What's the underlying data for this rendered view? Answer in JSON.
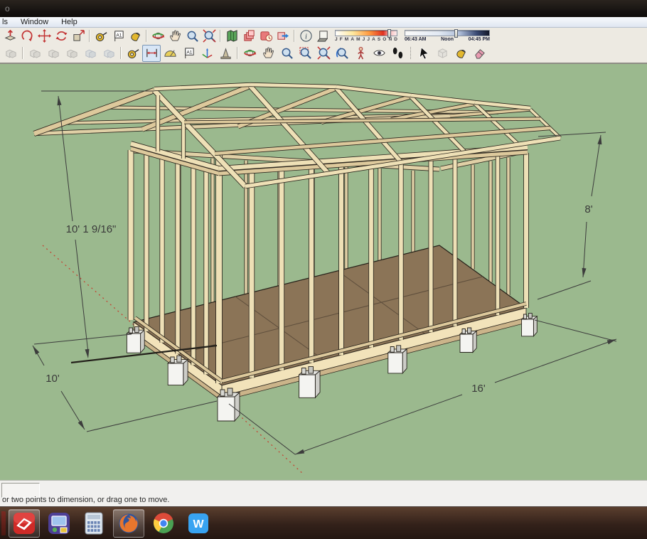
{
  "window": {
    "title_hint": "o"
  },
  "menubar": {
    "items": [
      "ls",
      "Window",
      "Help"
    ]
  },
  "shadows": {
    "months": [
      "J",
      "F",
      "M",
      "A",
      "M",
      "J",
      "J",
      "A",
      "S",
      "O",
      "N",
      "D"
    ],
    "month_handle": 0.84,
    "time_handle": 0.58,
    "time_start": "06:43 AM",
    "time_mid": "Noon",
    "time_end": "04:45 PM"
  },
  "toolbar_row1": {
    "icons": [
      {
        "name": "push-pull",
        "glyph": "pushpull",
        "color": "#c23232"
      },
      {
        "name": "follow-me",
        "glyph": "follow",
        "color": "#c23232"
      },
      {
        "name": "move",
        "glyph": "move",
        "color": "#c23232"
      },
      {
        "name": "rotate",
        "glyph": "rotate",
        "color": "#c23232"
      },
      {
        "name": "scale",
        "glyph": "scale",
        "color": "#c23232"
      },
      {
        "name": "tape-measure",
        "glyph": "tape",
        "color": "#e2b72e",
        "separator": true
      },
      {
        "name": "text",
        "glyph": "a1",
        "color": "#444444"
      },
      {
        "name": "paint-bucket",
        "glyph": "bucket",
        "color": "#e2b72e"
      },
      {
        "name": "orbit",
        "glyph": "orbit",
        "color": "#3a9d3a",
        "separator": true
      },
      {
        "name": "pan",
        "glyph": "hand",
        "color": "#f3e3cb"
      },
      {
        "name": "zoom",
        "glyph": "mag",
        "color": "#4a7ab5"
      },
      {
        "name": "zoom-extents",
        "glyph": "magx",
        "color": "#4a7ab5"
      },
      {
        "name": "add-location",
        "glyph": "map",
        "color": "#5aa55a",
        "separator": true
      },
      {
        "name": "toggle-terrain",
        "glyph": "stack",
        "color": "#c23232"
      },
      {
        "name": "photo-textures",
        "glyph": "clock",
        "color": "#c23232"
      },
      {
        "name": "share-model",
        "glyph": "arrowblue",
        "color": "#2e7fd6"
      },
      {
        "name": "shadow-settings",
        "glyph": "info",
        "color": "#334455",
        "separator": true
      },
      {
        "name": "shadow-toggle",
        "glyph": "shadowbox",
        "color": "#555555"
      },
      {
        "slider": "month"
      },
      {
        "slider": "time"
      }
    ]
  },
  "toolbar_row2": {
    "icons": [
      {
        "name": "outer-shell",
        "glyph": "cubes",
        "color": "#888888",
        "disabled": true
      },
      {
        "name": "solid-union",
        "glyph": "cubes",
        "color": "#888888",
        "disabled": true,
        "separator": true
      },
      {
        "name": "solid-subtract",
        "glyph": "cubes",
        "color": "#888888",
        "disabled": true
      },
      {
        "name": "solid-trim",
        "glyph": "cubes",
        "color": "#888888",
        "disabled": true
      },
      {
        "name": "solid-intersect",
        "glyph": "cubes2",
        "color": "#6aa0d8",
        "disabled": true
      },
      {
        "name": "solid-split",
        "glyph": "cubes2",
        "color": "#6aa0d8",
        "disabled": true
      },
      {
        "name": "tape-measure-2",
        "glyph": "tape",
        "color": "#e2b72e",
        "separator": true
      },
      {
        "name": "dimension",
        "glyph": "dim",
        "color": "#444444",
        "selected": true
      },
      {
        "name": "protractor",
        "glyph": "protractor",
        "color": "#e8cf5a"
      },
      {
        "name": "text-2",
        "glyph": "a1",
        "color": "#444444"
      },
      {
        "name": "axes",
        "glyph": "axes",
        "color": "#c23232"
      },
      {
        "name": "3d-text",
        "glyph": "text3d",
        "color": "#b0a080"
      },
      {
        "name": "orbit-2",
        "glyph": "orbit",
        "color": "#3a9d3a",
        "separator": true
      },
      {
        "name": "pan-2",
        "glyph": "hand",
        "color": "#f3e3cb"
      },
      {
        "name": "zoom-2",
        "glyph": "mag",
        "color": "#4a7ab5"
      },
      {
        "name": "zoom-window",
        "glyph": "magwin",
        "color": "#4a7ab5"
      },
      {
        "name": "zoom-extents-2",
        "glyph": "magx",
        "color": "#4a7ab5"
      },
      {
        "name": "zoom-previous",
        "glyph": "magprev",
        "color": "#4a7ab5"
      },
      {
        "name": "position-camera",
        "glyph": "poscam",
        "color": "#a83333"
      },
      {
        "name": "look-around",
        "glyph": "eye",
        "color": "#333333"
      },
      {
        "name": "walk",
        "glyph": "feet",
        "color": "#181818"
      },
      {
        "name": "select",
        "glyph": "cursor",
        "color": "#111111",
        "separator": "dotted"
      },
      {
        "name": "make-component",
        "glyph": "component",
        "color": "#999999",
        "disabled": true
      },
      {
        "name": "paint-bucket-2",
        "glyph": "bucket",
        "color": "#e2b72e"
      },
      {
        "name": "eraser",
        "glyph": "eraser",
        "color": "#e89ab0"
      }
    ]
  },
  "viewport": {
    "dims": {
      "ridge_height": "10' 1 9/16\"",
      "wall_height": "8'",
      "width": "10'",
      "length": "16'"
    }
  },
  "statusbar": {
    "hint": "or two points to dimension, or drag one to move."
  },
  "taskbar": {
    "items": [
      {
        "name": "sketchup",
        "glyph": "sketchup",
        "active": true,
        "label": ""
      },
      {
        "name": "games-explorer",
        "glyph": "games",
        "active": false,
        "label": ""
      },
      {
        "name": "calculator",
        "glyph": "calc",
        "active": false,
        "label": ""
      },
      {
        "name": "firefox",
        "glyph": "firefox",
        "active": true,
        "label": ""
      },
      {
        "name": "chrome",
        "glyph": "chrome",
        "active": false,
        "label": ""
      },
      {
        "name": "wps-writer",
        "glyph": "wps",
        "active": false,
        "label": "W"
      }
    ]
  },
  "colors": {
    "viewport_bg": "#9bb98e",
    "wood_light": "#eee0b6",
    "wood_mid": "#ddc99c",
    "wood_back": "#e0d0a6",
    "wood_outline": "#2e281f",
    "floor": "#8b7457",
    "rim": "#f2e3ba",
    "dim_text": "#3a3a3a",
    "dim_line": "#3c3c3c",
    "axis_red": "#c44433"
  }
}
